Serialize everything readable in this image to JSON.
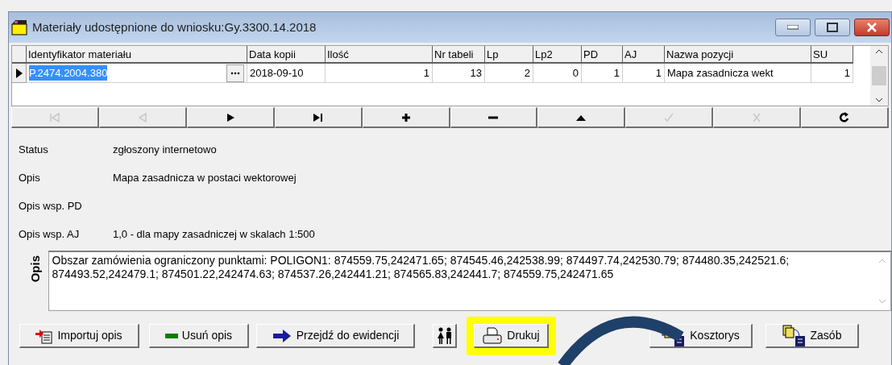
{
  "window": {
    "title": "Materiały udostępnione do wniosku:Gy.3300.14.2018"
  },
  "table": {
    "columns": [
      "Identyfikator materiału",
      "Data kopii",
      "Ilość",
      "Nr tabeli",
      "Lp",
      "Lp2",
      "PD",
      "AJ",
      "Nazwa pozycji",
      "SU"
    ],
    "rows": [
      {
        "selected": true,
        "cells": [
          "P.2474.2004.380",
          "2018-09-10",
          "1",
          "13",
          "2",
          "0",
          "1",
          "1",
          "Mapa zasadnicza wekt",
          "1"
        ]
      }
    ]
  },
  "navigator": [
    {
      "kind": "first",
      "disabled": true
    },
    {
      "kind": "prior",
      "disabled": true
    },
    {
      "kind": "next",
      "disabled": false
    },
    {
      "kind": "last",
      "disabled": false
    },
    {
      "kind": "insert",
      "disabled": false
    },
    {
      "kind": "delete",
      "disabled": false
    },
    {
      "kind": "edit",
      "disabled": false
    },
    {
      "kind": "post",
      "disabled": true
    },
    {
      "kind": "cancel",
      "disabled": true
    },
    {
      "kind": "refresh",
      "disabled": false
    }
  ],
  "fields": [
    {
      "label": "Status",
      "value": "zgłoszony internetowo"
    },
    {
      "label": "Opis",
      "value": "Mapa zasadnicza w postaci wektorowej"
    },
    {
      "label": "Opis wsp. PD"
    },
    {
      "label": "Opis wsp. AJ",
      "value": "1,0 - dla mapy zasadniczej w skalach 1:500"
    }
  ],
  "memo": {
    "label": "Opis",
    "value": "Obszar zamówienia ograniczony punktami: POLIGON1: 874559.75,242471.65; 874545.46,242538.99; 874497.74,242530.79; 874480.35,242521.6; 874493.52,242479.1; 874501.22,242474.63; 874537.26,242441.21; 874565.83,242441.7; 874559.75,242471.65"
  },
  "buttons": [
    {
      "kind": "import",
      "label": "Importuj opis",
      "highlighted": false
    },
    {
      "kind": "remove",
      "label": "Usuń opis",
      "highlighted": false
    },
    {
      "kind": "goto",
      "label": "Przejdź do ewidencji",
      "highlighted": false
    },
    {
      "kind": "people",
      "highlighted": false
    },
    {
      "kind": "print",
      "label": "Drukuj",
      "highlighted": true
    },
    {
      "kind": "cost",
      "label": "Kosztorys",
      "highlighted": false
    },
    {
      "kind": "stock",
      "label": "Zasób",
      "highlighted": false
    }
  ]
}
